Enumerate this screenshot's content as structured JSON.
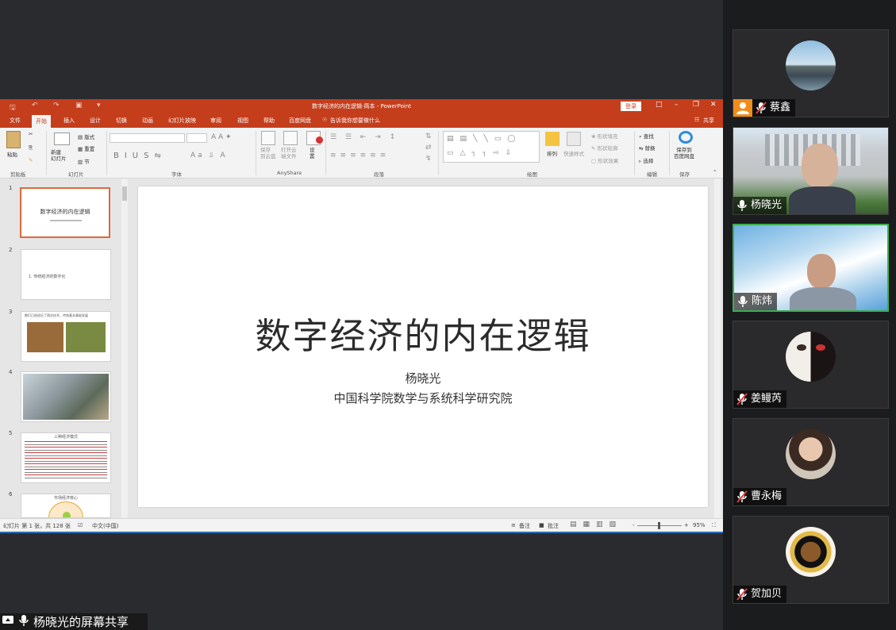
{
  "ppt": {
    "window_title": "数字经济的内在逻辑-简本 - PowerPoint",
    "login_label": "登录",
    "share_label": "共享",
    "tabs": [
      "文件",
      "开始",
      "插入",
      "设计",
      "切换",
      "动画",
      "幻灯片放映",
      "审阅",
      "视图",
      "帮助",
      "百度网盘"
    ],
    "tell_me": "告诉我你想要做什么",
    "ribbon": {
      "paste": "粘贴",
      "clipboard": "剪贴板",
      "new_slide": "新建\n幻灯片",
      "layout": "版式",
      "reset": "重置",
      "section": "节",
      "slides_group": "幻灯片",
      "font_group": "字体",
      "save_anyshare": "保存\n到云盘",
      "open_cloud": "打开云\n端文件",
      "settings": "设\n置",
      "anyshare_group": "AnyShare",
      "paragraph_group": "段落",
      "arrange": "排列",
      "quick_styles": "快速样式",
      "shape_fill": "形状填充",
      "shape_outline": "形状轮廓",
      "shape_effects": "形状效果",
      "drawing_group": "绘图",
      "find": "查找",
      "replace": "替换",
      "select": "选择",
      "editing_group": "编辑",
      "save_baidu": "保存到\n百度网盘",
      "save_group": "保存"
    },
    "thumbnails": [
      {
        "num": "1",
        "text": "数字经济的内在逻辑"
      },
      {
        "num": "2",
        "text": "1. 传统经济的数字化"
      },
      {
        "num": "3",
        "text": "数们已经经历了两次技术、传统基本基础发展"
      },
      {
        "num": "4",
        "text": ""
      },
      {
        "num": "5",
        "text": "三种经济模式"
      },
      {
        "num": "6",
        "text": "市场经济核心"
      }
    ],
    "slide": {
      "title": "数字经济的内在逻辑",
      "author": "杨晓光",
      "institution": "中国科学院数学与系统科学研究院"
    },
    "status": {
      "slide_info": "幻灯片 第 1 张，共 128 张",
      "language": "中文(中国)",
      "notes": "备注",
      "comments": "批注",
      "zoom": "95%"
    }
  },
  "participants": [
    {
      "name": "蔡鑫",
      "muted": true,
      "host": true
    },
    {
      "name": "杨晓光",
      "muted": false
    },
    {
      "name": "陈炜",
      "muted": false,
      "active": true
    },
    {
      "name": "姜鳗芮",
      "muted": true
    },
    {
      "name": "曹永梅",
      "muted": true
    },
    {
      "name": "贺加贝",
      "muted": true
    }
  ],
  "share_status": "杨晓光的屏幕共享",
  "colors": {
    "ppt_accent": "#c43e1c",
    "active_speaker": "#3dae4f",
    "host_badge": "#f08c1c"
  }
}
